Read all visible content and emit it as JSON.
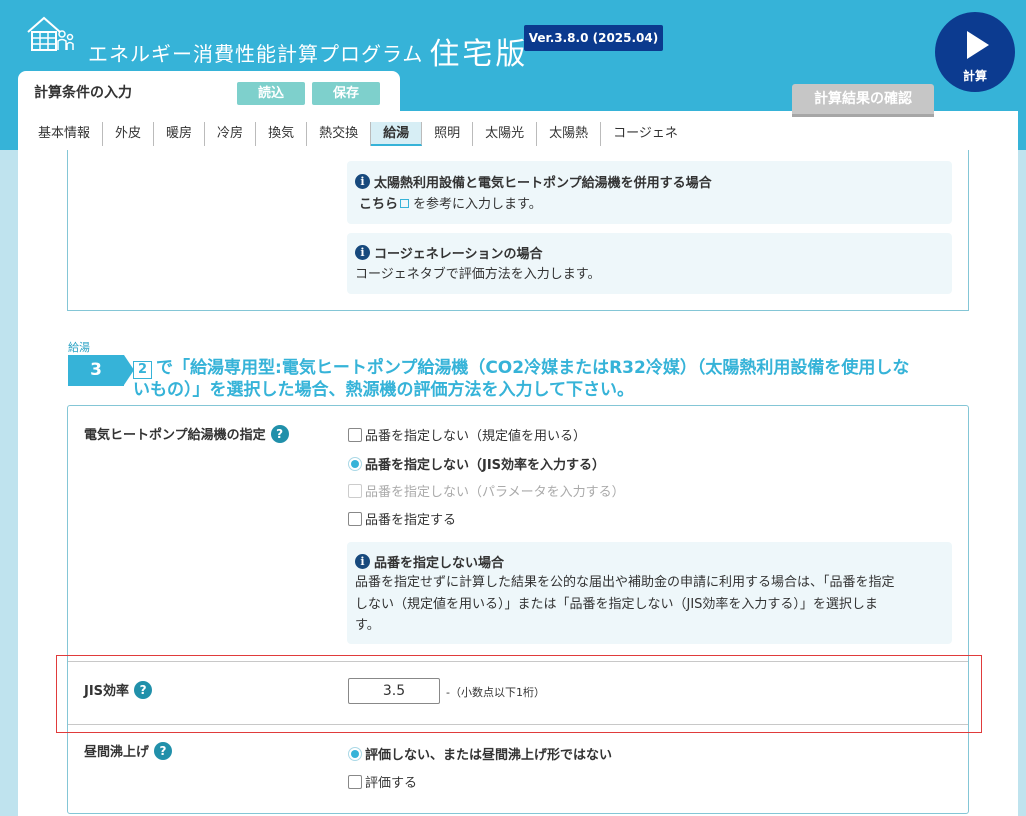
{
  "header": {
    "title_prefix": "エネルギー消費性能計算プログラム",
    "title_main": "住宅版",
    "version": "Ver.3.8.0 (2025.04)",
    "calc_label": "計算"
  },
  "input_tab": {
    "title": "計算条件の入力",
    "load_label": "読込",
    "save_label": "保存"
  },
  "result_tab": {
    "label": "計算結果の確認"
  },
  "tabs": [
    {
      "label": "基本情報"
    },
    {
      "label": "外皮"
    },
    {
      "label": "暖房"
    },
    {
      "label": "冷房"
    },
    {
      "label": "換気"
    },
    {
      "label": "熱交換"
    },
    {
      "label": "給湯"
    },
    {
      "label": "照明"
    },
    {
      "label": "太陽光"
    },
    {
      "label": "太陽熱"
    },
    {
      "label": "コージェネ"
    }
  ],
  "active_tab": "給湯",
  "prev_section": {
    "info1": {
      "title": "太陽熱利用設備と電気ヒートポンプ給湯機を併用する場合",
      "link": "こちら",
      "text": "を参考に入力します。"
    },
    "info2": {
      "title": "コージェネレーションの場合",
      "text": "コージェネタブで評価方法を入力します。"
    }
  },
  "section": {
    "sub": "給湯",
    "number": "3",
    "step_ref": "2",
    "title_line1": "で「給湯専用型:電気ヒートポンプ給湯機（CO2冷媒またはR32冷媒）（太陽熱利用設備を使用しな",
    "title_line2": "いもの）」を選択した場合、熱源機の評価方法を入力して下さい。"
  },
  "hp_spec": {
    "label": "電気ヒートポンプ給湯機の指定",
    "options": [
      "品番を指定しない（規定値を用いる）",
      "品番を指定しない（JIS効率を入力する）",
      "品番を指定しない（パラメータを入力する）",
      "品番を指定する"
    ],
    "info": {
      "title": "品番を指定しない場合",
      "line1": "品番を指定せずに計算した結果を公的な届出や補助金の申請に利用する場合は、「品番を指定",
      "line2": "しない（規定値を用いる）」または「品番を指定しない（JIS効率を入力する）」を選択しま",
      "line3": "す。"
    }
  },
  "jis": {
    "label": "JIS効率",
    "value": "3.5",
    "unit": "-（小数点以下1桁）"
  },
  "daytime": {
    "label": "昼間沸上げ",
    "options": [
      "評価しない、または昼間沸上げ形ではない",
      "評価する"
    ]
  },
  "colors": {
    "primary": "#36b3d8",
    "navy": "#0c3b90",
    "highlight": "#e03b3b"
  }
}
